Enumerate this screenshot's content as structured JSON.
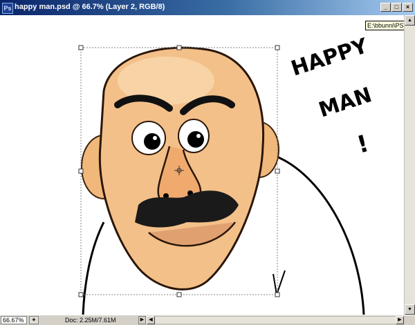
{
  "window": {
    "title": "happy man.psd @ 66.7% (Layer 2, RGB/8)",
    "app_icon": "Ps",
    "buttons": {
      "minimize": "_",
      "maximize": "□",
      "close": "×"
    }
  },
  "tooltip": {
    "text": "E:\\bbunni\\PST\\ha"
  },
  "artwork": {
    "line1": "HAPPY",
    "line2": "MAN",
    "exclaim": "!"
  },
  "status": {
    "zoom": "66.67%",
    "doc_info": "Doc: 2.25M/7.61M"
  },
  "icons": {
    "title": "photoshop-icon",
    "status": "status-preview-icon",
    "arrow": "triangle-right-icon"
  }
}
